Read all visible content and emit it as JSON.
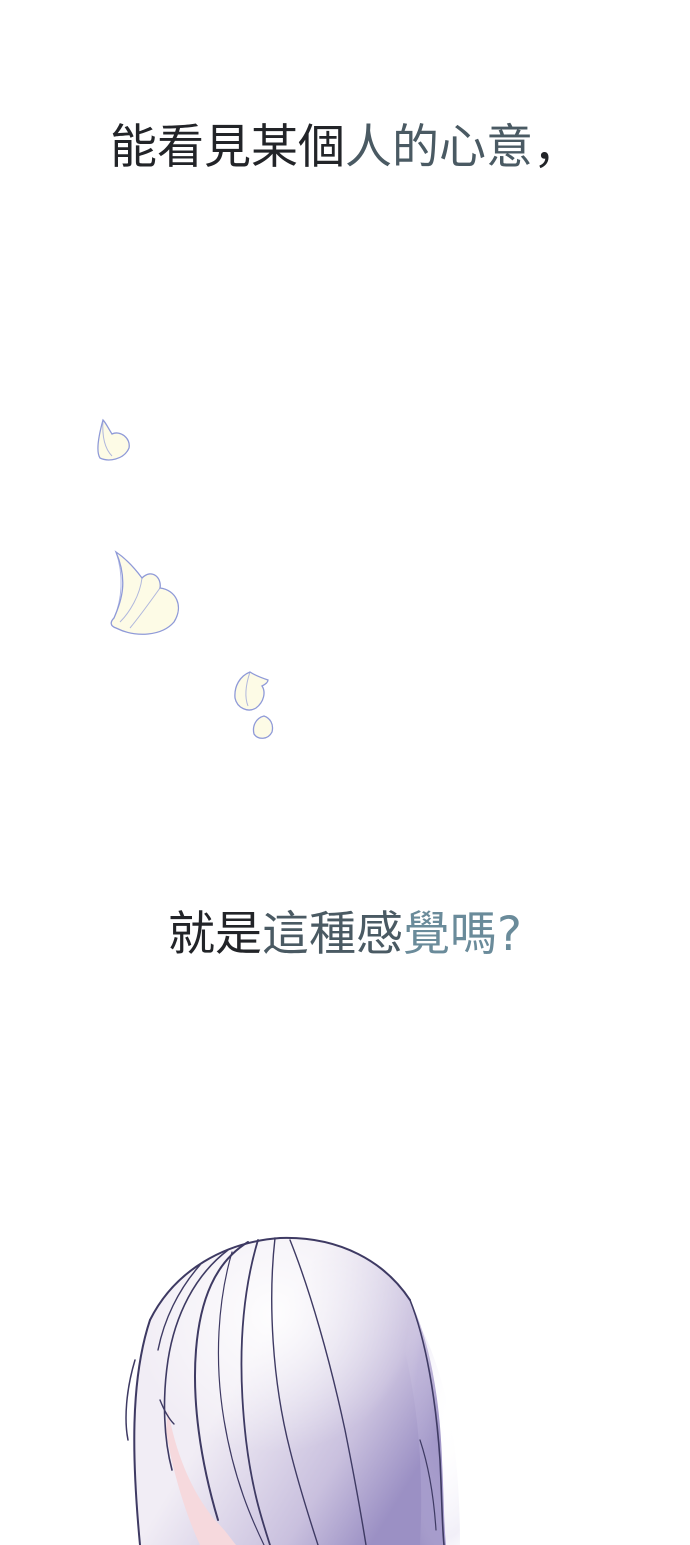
{
  "captions": [
    {
      "segments": [
        {
          "text": "能看見某個",
          "color": "#222428"
        },
        {
          "text": "人的心意",
          "color": "#4a5a63"
        },
        {
          "text": "，",
          "color": "#222428"
        }
      ]
    },
    {
      "segments": [
        {
          "text": "就是",
          "color": "#222428"
        },
        {
          "text": "這種感",
          "color": "#4a5a63"
        },
        {
          "text": "覺嗎?",
          "color": "#6a8b9a"
        }
      ]
    }
  ],
  "colors": {
    "background": "#ffffff",
    "petal_fill": "#fdfbe6",
    "petal_stroke": "#8f9ad8",
    "hair_light": "#f1edf5",
    "hair_mid": "#c9c0de",
    "hair_shadow": "#9b90c4",
    "hair_line": "#3e3a63",
    "skin": "#f6d9dd"
  },
  "illustration": {
    "petals": "five-falling-petals",
    "figure": "silver-haired-character-head-back-view"
  }
}
